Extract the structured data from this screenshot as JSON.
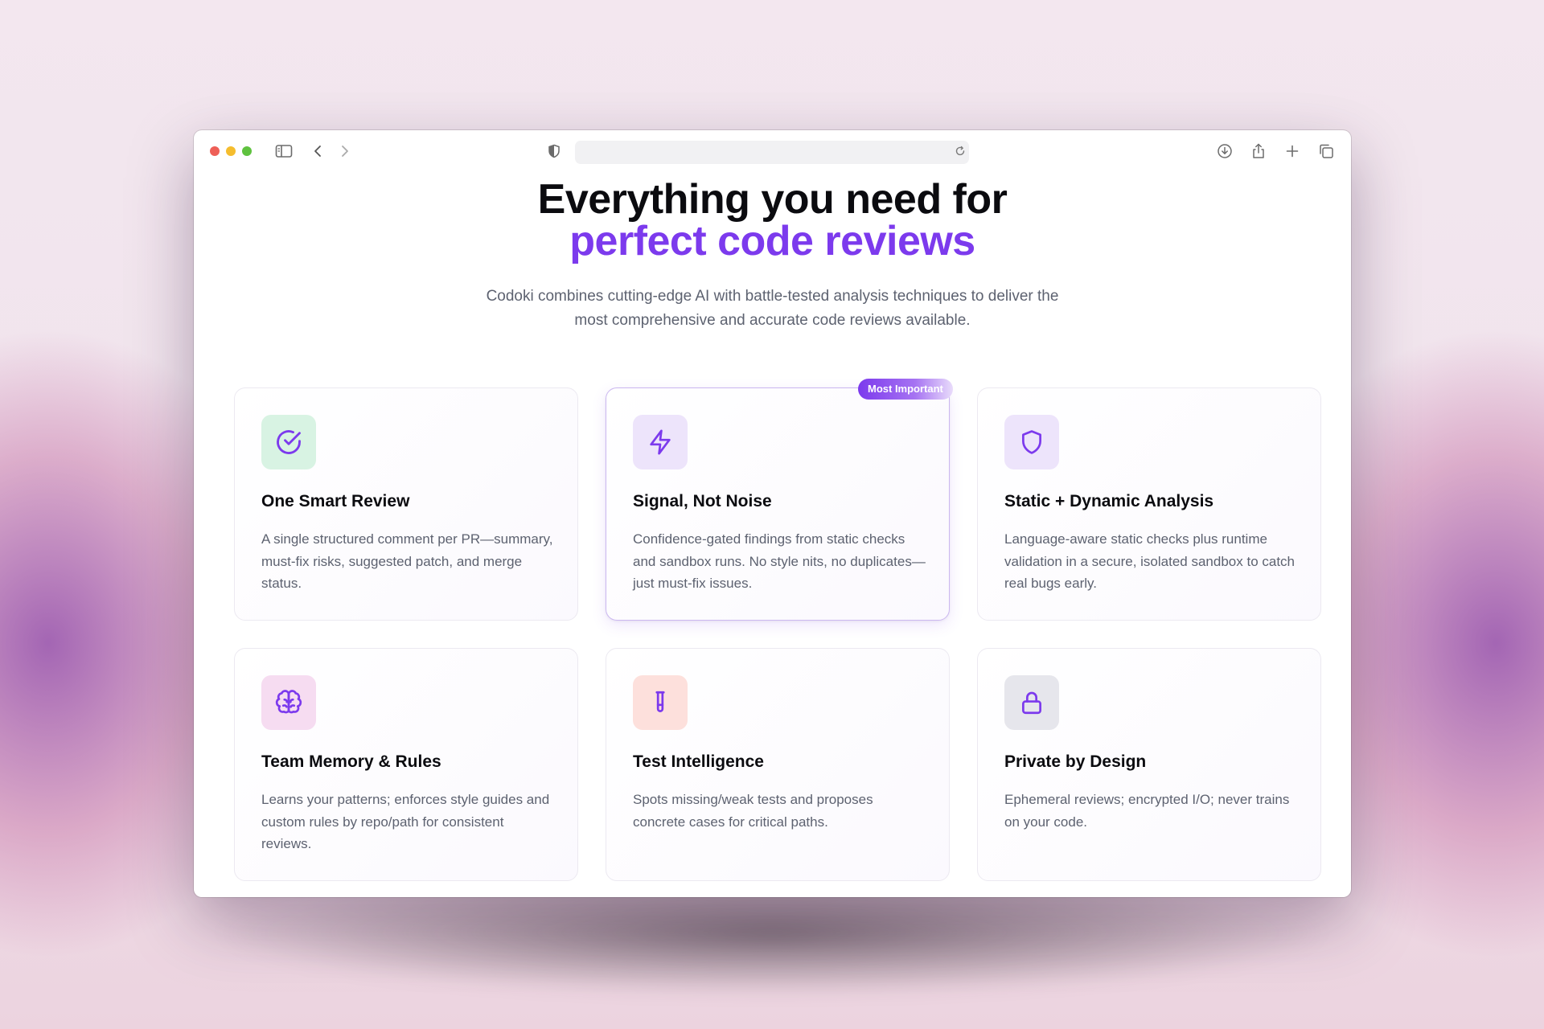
{
  "hero": {
    "title_line1": "Everything you need for",
    "title_line2": "perfect code reviews",
    "subtitle": "Codoki combines cutting-edge AI with battle-tested analysis techniques to deliver the most comprehensive and accurate code reviews available."
  },
  "browser": {
    "url": "",
    "icons": [
      "sidebar-icon",
      "back-icon",
      "forward-icon",
      "shield-icon",
      "reload-icon",
      "download-icon",
      "share-icon",
      "new-tab-icon",
      "tabs-overview-icon"
    ]
  },
  "colors": {
    "accent": "#7c3aed",
    "traffic_red": "#ee5f57",
    "traffic_yellow": "#f5bd2e",
    "traffic_green": "#5fc23f"
  },
  "features": [
    {
      "title": "One Smart Review",
      "description": "A single structured comment per PR—summary, must-fix risks, suggested patch, and merge status.",
      "icon": "check-circle-icon",
      "tile_color": "#d8f3e3"
    },
    {
      "title": "Signal, Not Noise",
      "description": "Confidence-gated findings from static checks and sandbox runs. No style nits, no duplicates—just must-fix issues.",
      "icon": "lightning-icon",
      "tile_color": "#ede4fb",
      "badge": "Most Important"
    },
    {
      "title": "Static + Dynamic Analysis",
      "description": "Language-aware static checks plus runtime validation in a secure, isolated sandbox to catch real bugs early.",
      "icon": "shield-icon",
      "tile_color": "#ede4fb"
    },
    {
      "title": "Team Memory & Rules",
      "description": "Learns your patterns; enforces style guides and custom rules by repo/path for consistent reviews.",
      "icon": "brain-icon",
      "tile_color": "#f6dcf1"
    },
    {
      "title": "Test Intelligence",
      "description": "Spots missing/weak tests and proposes concrete cases for critical paths.",
      "icon": "test-tube-icon",
      "tile_color": "#fde0dc"
    },
    {
      "title": "Private by Design",
      "description": "Ephemeral reviews; encrypted I/O; never trains on your code.",
      "icon": "lock-icon",
      "tile_color": "#e6e6ec"
    }
  ]
}
